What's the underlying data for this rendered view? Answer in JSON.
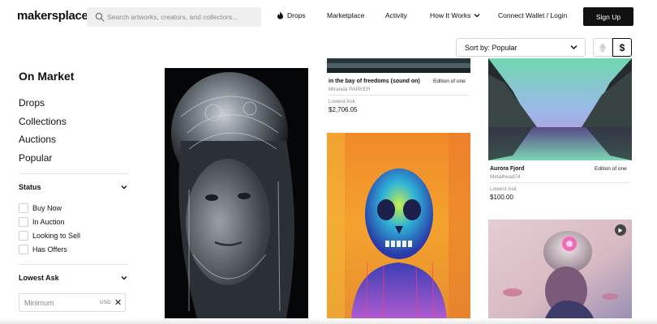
{
  "header": {
    "logo": "makersplace",
    "search_placeholder": "Search artworks, creators, and collectors...",
    "nav": {
      "drops": "Drops",
      "marketplace": "Marketplace",
      "activity": "Activity",
      "how_it_works": "How It Works",
      "connect_wallet": "Connect Wallet / Login",
      "sign_up": "Sign Up"
    }
  },
  "toolbar": {
    "sort_label": "Sort by: Popular",
    "currency_usd": "$"
  },
  "sidebar": {
    "title": "On Market",
    "links": [
      "Drops",
      "Collections",
      "Auctions",
      "Popular"
    ],
    "status": {
      "heading": "Status",
      "options": [
        "Buy Now",
        "In Auction",
        "Looking to Sell",
        "Has Offers"
      ]
    },
    "lowest_ask": {
      "heading": "Lowest Ask",
      "min_placeholder": "Minimum",
      "unit": "USD",
      "clear": "✕"
    }
  },
  "cards": {
    "bay": {
      "title": "in the bay of freedoms (sound on)",
      "edition": "Edition of one",
      "creator": "Miranda PARKER",
      "ask_label": "Lowest Ask",
      "ask_value": "$2,706.05"
    },
    "fjord": {
      "title": "Aurora Fjord",
      "edition": "Edition of one",
      "creator": "Metalhead74",
      "ask_label": "Lowest Ask",
      "ask_value": "$100.00"
    }
  },
  "colors": {
    "brand": "#111111",
    "signup_bg": "#111111",
    "divider": "#e2e2e2"
  }
}
